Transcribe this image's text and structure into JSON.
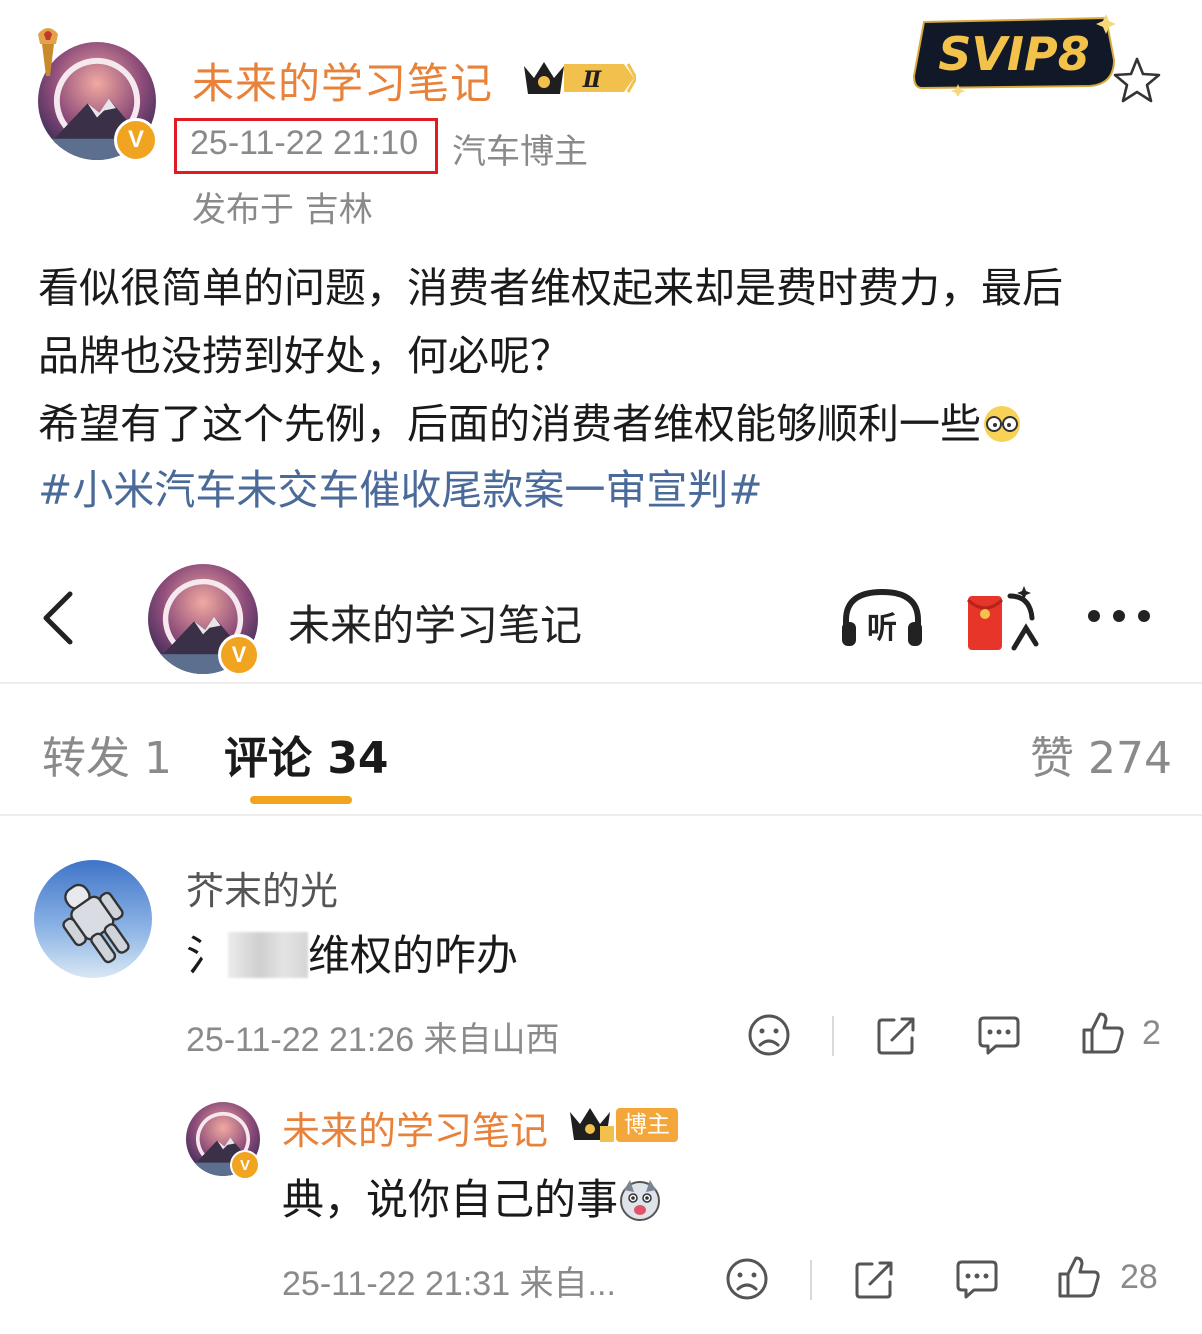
{
  "post": {
    "author_name": "未来的学习笔记",
    "vip_level": "Ⅱ",
    "svip_label": "SVIP8",
    "time": "25-11-22 21:10",
    "author_tag": "汽车博主",
    "location": "发布于 吉林",
    "body_lines": [
      "看似很简单的问题，消费者维权起来却是费时费力，最后",
      "品牌也没捞到好处，何必呢？",
      "希望有了这个先例，后面的消费者维权能够顺利一些"
    ],
    "hashtag": "#小米汽车未交车催收尾款案一审宣判#"
  },
  "nav": {
    "title": "未来的学习笔记",
    "listen_label": "听",
    "icons": [
      "back-icon",
      "listen-icon",
      "red-packet-icon",
      "more-icon"
    ]
  },
  "tabs": {
    "repost": "转发 1",
    "comment": "评论 34",
    "like": "赞 274",
    "active": "comment"
  },
  "comments": [
    {
      "user": "芥末的光",
      "text_prefix": "氵",
      "text_suffix": "维权的咋办",
      "meta": "25-11-22 21:26 来自山西",
      "likes": "2"
    },
    {
      "user": "未来的学习笔记",
      "badge": "博主",
      "text": "典，说你自己的事",
      "meta": "25-11-22 21:31 来自...",
      "likes": "28"
    }
  ],
  "colors": {
    "author": "#e8813a",
    "hashtag": "#4a6a99",
    "accent": "#f0a420",
    "highlight_box": "#e01b24",
    "meta_text": "#8a8a8a"
  }
}
